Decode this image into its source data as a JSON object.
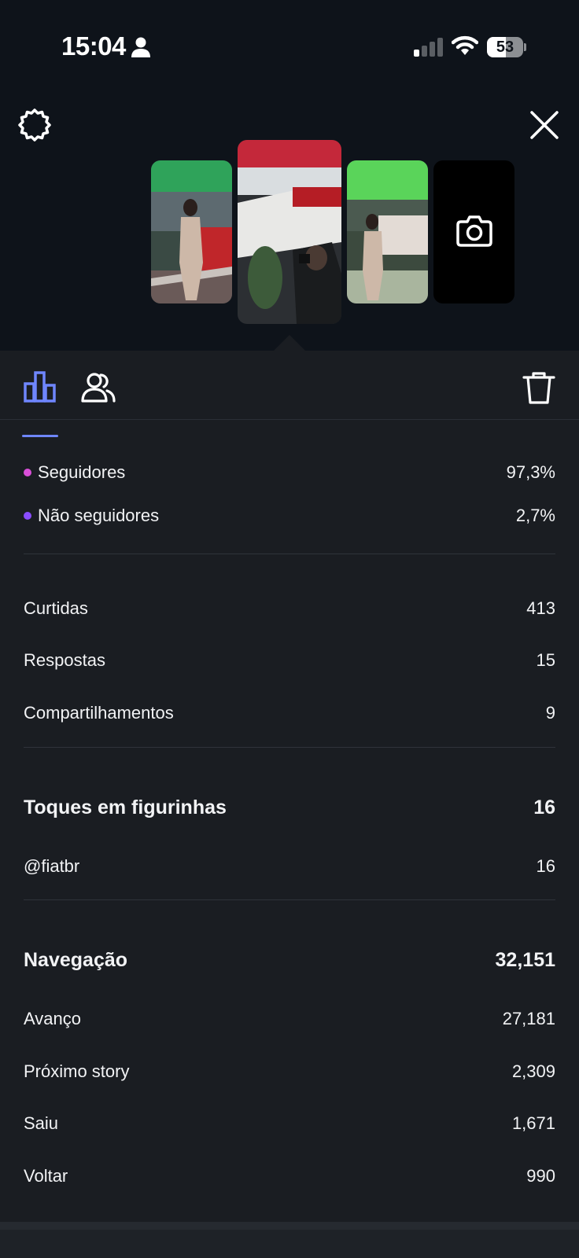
{
  "status_bar": {
    "time": "15:04",
    "battery": "53",
    "battery_level": 0.53
  },
  "icons": {
    "settings": "gear-icon",
    "close": "close-icon",
    "camera": "camera-icon",
    "insights_tab": "bar-chart-icon",
    "viewers_tab": "people-icon",
    "delete": "trash-icon"
  },
  "colors": {
    "accent": "#6f86ff",
    "followers_dot": "#d94fd8",
    "non_followers_dot": "#8a4dff",
    "sheet_bg": "#1a1d22",
    "page_bg": "#0e131a"
  },
  "audience": [
    {
      "label": "Seguidores",
      "value": "97,3%"
    },
    {
      "label": "Não seguidores",
      "value": "2,7%"
    }
  ],
  "interactions": [
    {
      "label": "Curtidas",
      "value": "413"
    },
    {
      "label": "Respostas",
      "value": "15"
    },
    {
      "label": "Compartilhamentos",
      "value": "9"
    }
  ],
  "sticker_taps": {
    "title": "Toques em figurinhas",
    "total": "16",
    "items": [
      {
        "label": "@fiatbr",
        "value": "16"
      }
    ]
  },
  "navigation": {
    "title": "Navegação",
    "total": "32,151",
    "items": [
      {
        "label": "Avanço",
        "value": "27,181"
      },
      {
        "label": "Próximo story",
        "value": "2,309"
      },
      {
        "label": "Saiu",
        "value": "1,671"
      },
      {
        "label": "Voltar",
        "value": "990"
      }
    ]
  }
}
